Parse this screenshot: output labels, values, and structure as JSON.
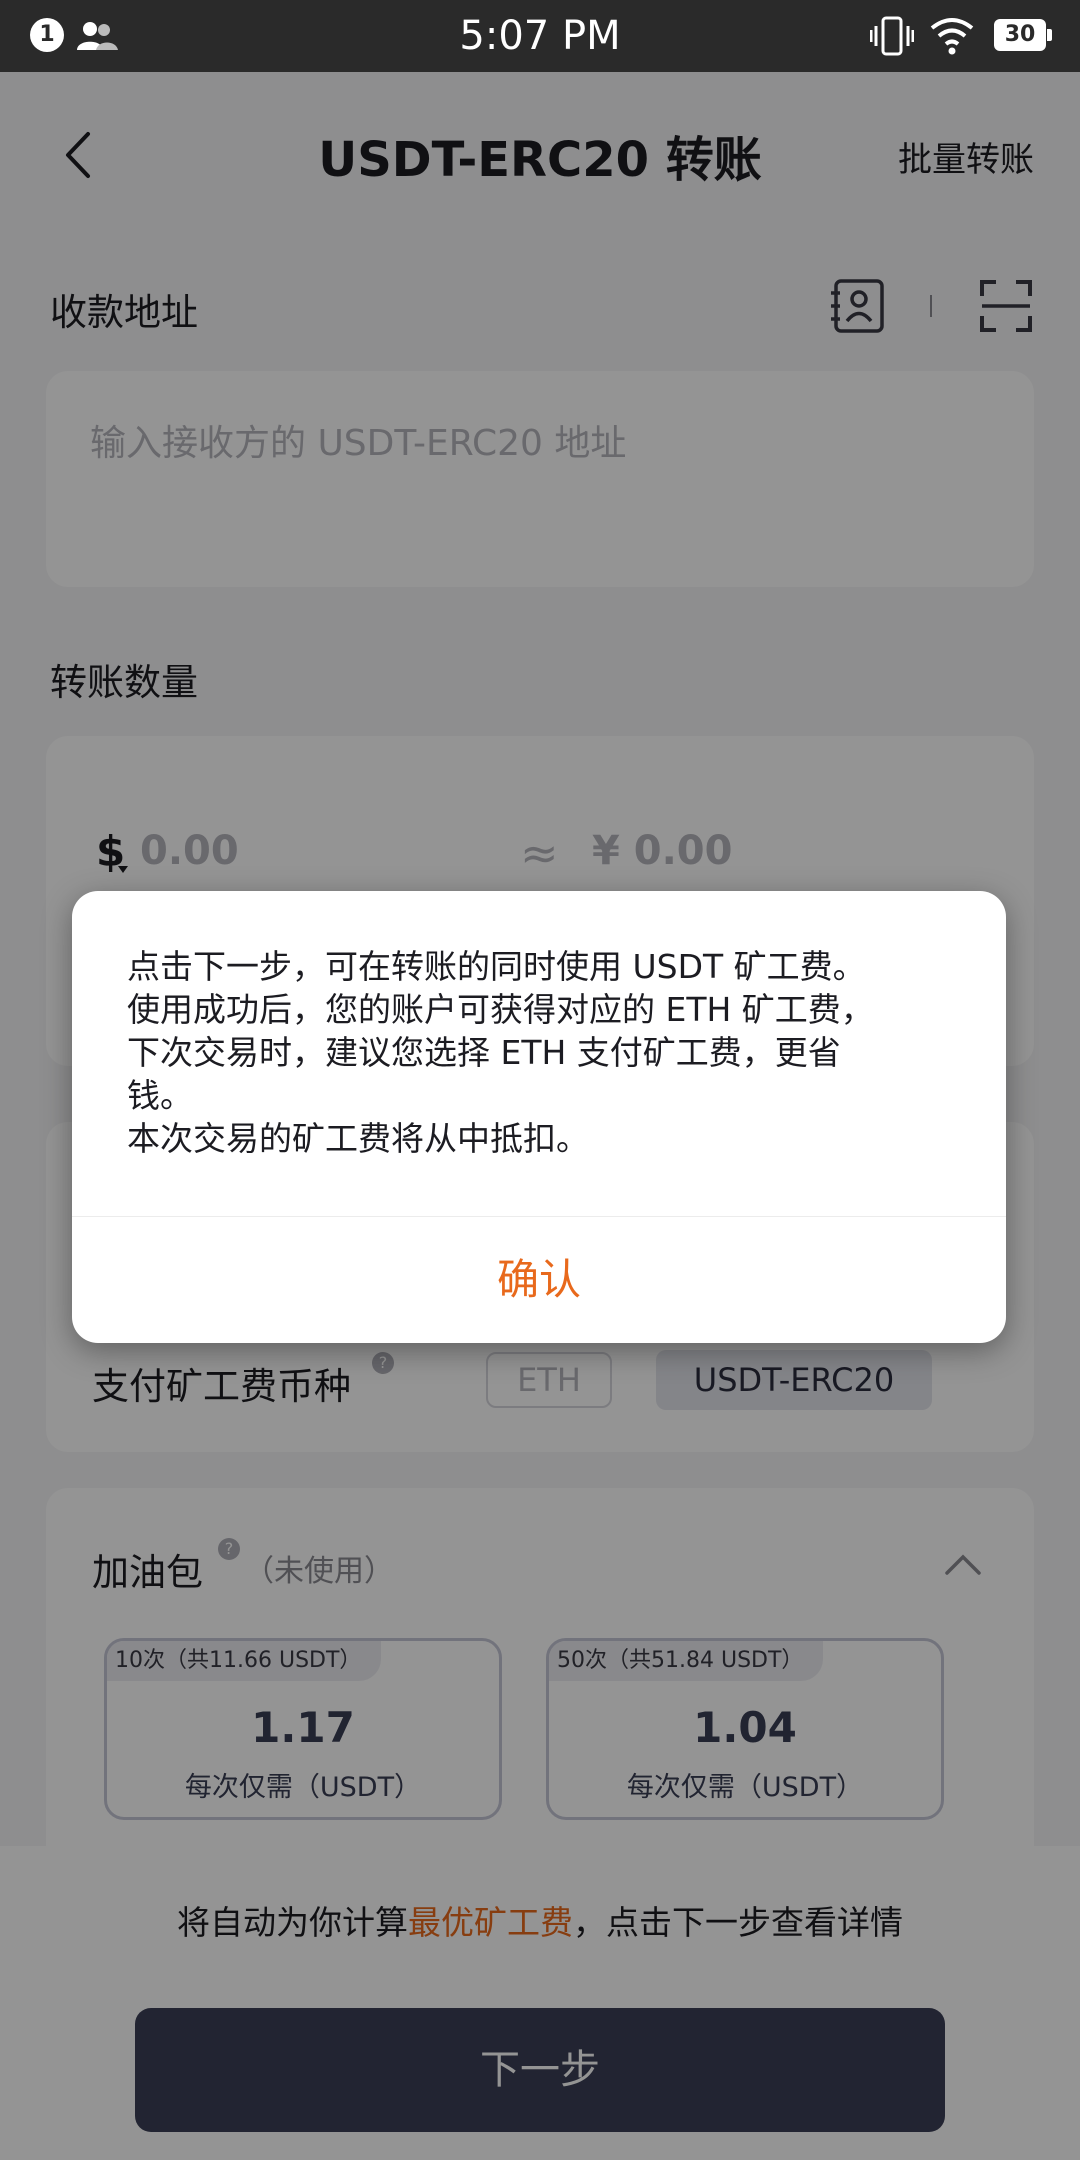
{
  "status_bar": {
    "notification_count": "1",
    "time": "5:07 PM",
    "battery": "30"
  },
  "header": {
    "title": "USDT-ERC20 转账",
    "batch_transfer": "批量转账"
  },
  "address": {
    "label": "收款地址",
    "placeholder": "输入接收方的 USDT-ERC20 地址"
  },
  "amount": {
    "label": "转账数量",
    "usd_value": "0.00",
    "approx_symbol": "≈",
    "cny_value": "¥ 0.00"
  },
  "fee_currency": {
    "label": "支付矿工费币种",
    "options": [
      "ETH",
      "USDT-ERC20"
    ],
    "selected": "USDT-ERC20"
  },
  "gas_package": {
    "label": "加油包",
    "status": "（未使用）",
    "packages": [
      {
        "tag": "10次（共11.66 USDT）",
        "value": "1.17",
        "unit": "每次仅需（USDT）"
      },
      {
        "tag": "50次（共51.84 USDT）",
        "value": "1.04",
        "unit": "每次仅需（USDT）"
      }
    ]
  },
  "footer": {
    "hint_before": "将自动为你计算",
    "hint_accent": "最优矿工费",
    "hint_after": "，点击下一步查看详情",
    "next_button": "下一步"
  },
  "dialog": {
    "lines": [
      "点击下一步，可在转账的同时使用 USDT 矿工费。",
      "使用成功后，您的账户可获得对应的 ETH 矿工费，",
      "下次交易时，建议您选择 ETH 支付矿工费，更省",
      "钱。",
      "本次交易的矿工费将从中抵扣。"
    ],
    "confirm": "确认"
  },
  "colors": {
    "accent": "#e8691c",
    "primary_button": "#3b3f56",
    "status_bar": "#2a2a2a"
  },
  "icons": [
    "back-arrow-icon",
    "contacts-book-icon",
    "scan-icon",
    "help-icon",
    "chevron-up-icon",
    "dollar-icon",
    "vibrate-icon",
    "wifi-icon",
    "battery-icon",
    "contacts-icon"
  ]
}
